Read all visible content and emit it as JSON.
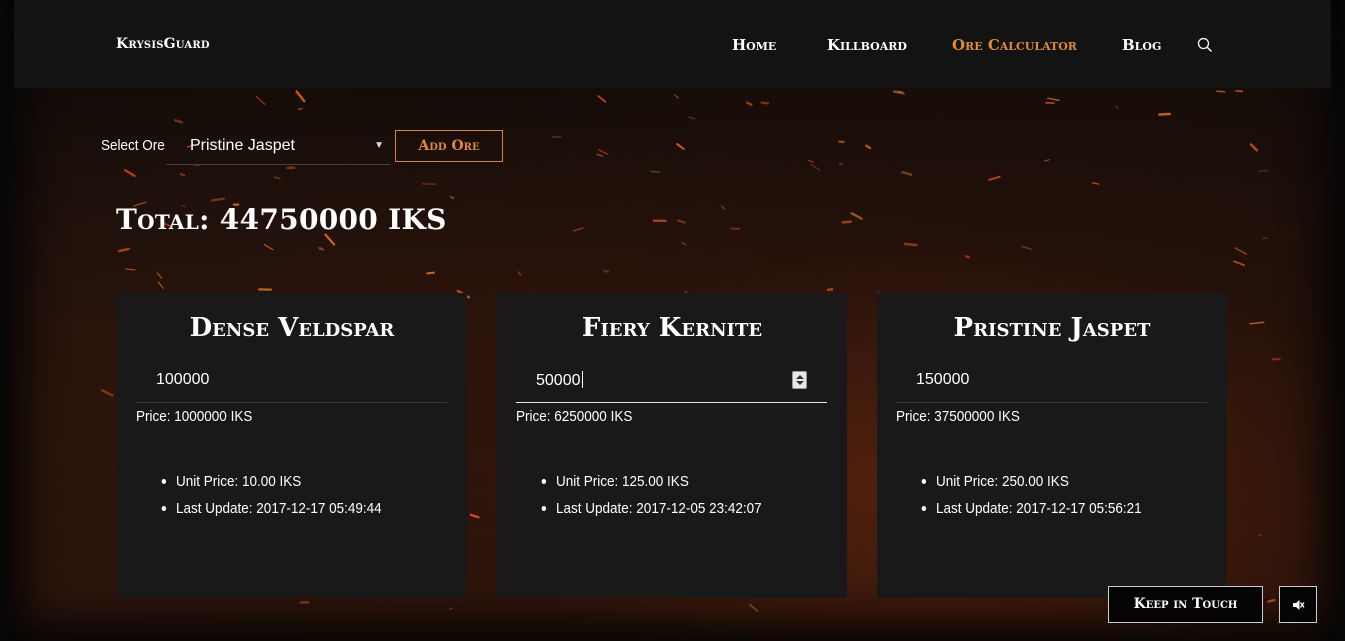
{
  "nav": {
    "brand": "KrysisGuard",
    "links": [
      "Home",
      "Killboard",
      "Ore Calculator",
      "Blog"
    ],
    "active": "Ore Calculator",
    "search_icon": "search-icon"
  },
  "ore_selector": {
    "label": "Select Ore",
    "selected": "Pristine Jaspet",
    "add_label": "Add Ore"
  },
  "total_text": "Total: 44750000 IKS",
  "cards": [
    {
      "title": "Dense Veldspar",
      "quantity": "100000",
      "price_text": "Price:  1000000 IKS",
      "unit_price_text": "Unit Price: 10.00 IKS",
      "last_update_text": "Last Update: 2017-12-17 05:49:44"
    },
    {
      "title": "Fiery Kernite",
      "quantity": "50000",
      "price_text": "Price:  6250000 IKS",
      "unit_price_text": "Unit Price: 125.00 IKS",
      "last_update_text": "Last Update: 2017-12-05 23:42:07"
    },
    {
      "title": "Pristine Jaspet",
      "quantity": "150000",
      "price_text": "Price:  37500000 IKS",
      "unit_price_text": "Unit Price: 250.00 IKS",
      "last_update_text": "Last Update: 2017-12-17 05:56:21"
    }
  ],
  "footer": {
    "keep_in_touch": "Keep in Touch",
    "mute_icon": "speaker-mute-icon"
  },
  "colors": {
    "accent": "#e08a36",
    "card_bg": "#191919",
    "nav_bg": "#131313"
  }
}
